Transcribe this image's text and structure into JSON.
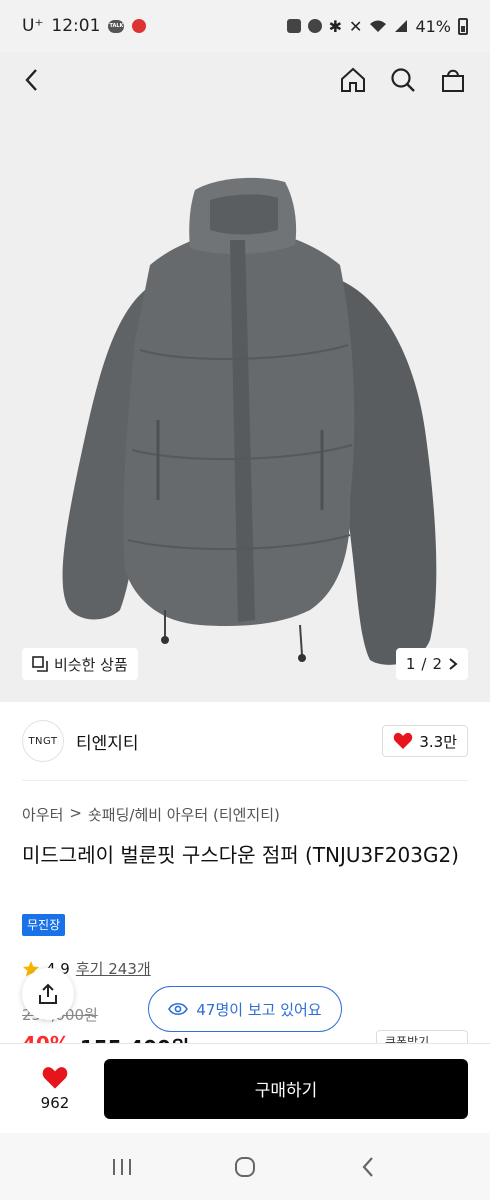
{
  "status_bar": {
    "carrier": "U⁺",
    "time": "12:01",
    "battery": "41%",
    "notification_label": "TALK"
  },
  "hero": {
    "similar_products_label": "비슷한 상품",
    "page_current": "1",
    "page_total": "2",
    "page_separator": "/"
  },
  "brand": {
    "logo_text": "TNGT",
    "name": "티엔지티",
    "likes": "3.3만"
  },
  "product": {
    "breadcrumb": [
      "아우터",
      ">",
      "숏패딩/헤비 아우터 (티엔지티)"
    ],
    "title": "미드그레이 벌룬핏 구스다운 점퍼 (TNJU3F203G2)",
    "badge": "무진장",
    "rating": "4.9",
    "reviews_label": "후기 243개",
    "original_price": "259,000원",
    "discount_pct": "40%",
    "sale_price": "155,400원",
    "coupon_label": "쿠폰받기"
  },
  "overlay": {
    "viewers_text": "47명이 보고 있어요"
  },
  "bottom_bar": {
    "wish_count": "962",
    "buy_label": "구매하기"
  },
  "colors": {
    "accent_blue": "#2e6fd8",
    "heart_red": "#e8141c",
    "discount_red": "#ff2c2c",
    "jacket_gray": "#666a6c"
  }
}
